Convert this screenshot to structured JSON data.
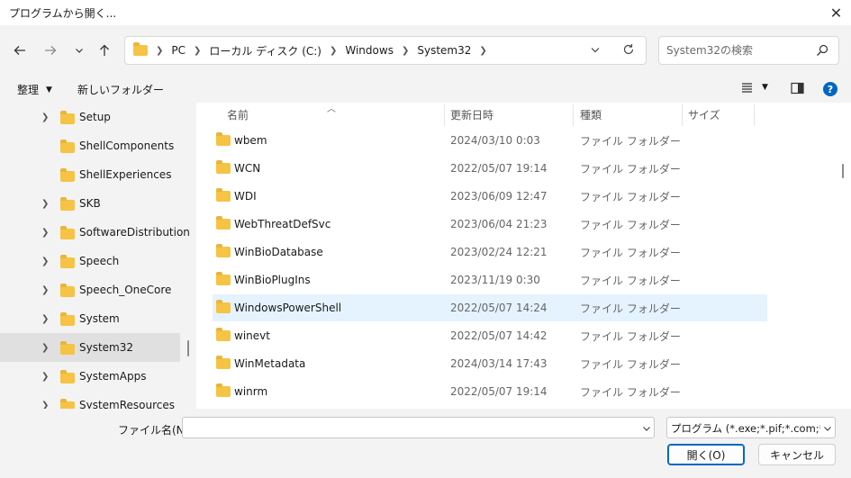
{
  "window": {
    "title": "プログラムから開く..."
  },
  "breadcrumb": [
    "PC",
    "ローカル ディスク (C:)",
    "Windows",
    "System32"
  ],
  "search": {
    "placeholder": "System32の検索"
  },
  "commandbar": {
    "organize": "整理",
    "new_folder": "新しいフォルダー"
  },
  "tree": [
    {
      "label": "Setup",
      "expandable": true
    },
    {
      "label": "ShellComponents",
      "expandable": false
    },
    {
      "label": "ShellExperiences",
      "expandable": false
    },
    {
      "label": "SKB",
      "expandable": true
    },
    {
      "label": "SoftwareDistribution",
      "expandable": true
    },
    {
      "label": "Speech",
      "expandable": true
    },
    {
      "label": "Speech_OneCore",
      "expandable": true
    },
    {
      "label": "System",
      "expandable": true
    },
    {
      "label": "System32",
      "expandable": true,
      "selected": true
    },
    {
      "label": "SystemApps",
      "expandable": true
    },
    {
      "label": "SystemResources",
      "expandable": true
    }
  ],
  "columns": {
    "name": "名前",
    "date": "更新日時",
    "type": "種類",
    "size": "サイズ"
  },
  "files": [
    {
      "name": "wbem",
      "date": "2024/03/10 0:03",
      "type": "ファイル フォルダー"
    },
    {
      "name": "WCN",
      "date": "2022/05/07 19:14",
      "type": "ファイル フォルダー"
    },
    {
      "name": "WDI",
      "date": "2023/06/09 12:47",
      "type": "ファイル フォルダー"
    },
    {
      "name": "WebThreatDefSvc",
      "date": "2023/06/04 21:23",
      "type": "ファイル フォルダー"
    },
    {
      "name": "WinBioDatabase",
      "date": "2023/02/24 12:21",
      "type": "ファイル フォルダー"
    },
    {
      "name": "WinBioPlugIns",
      "date": "2023/11/19 0:30",
      "type": "ファイル フォルダー"
    },
    {
      "name": "WindowsPowerShell",
      "date": "2022/05/07 14:24",
      "type": "ファイル フォルダー",
      "selected": true
    },
    {
      "name": "winevt",
      "date": "2022/05/07 14:42",
      "type": "ファイル フォルダー"
    },
    {
      "name": "WinMetadata",
      "date": "2024/03/14 17:43",
      "type": "ファイル フォルダー"
    },
    {
      "name": "winrm",
      "date": "2022/05/07 19:14",
      "type": "ファイル フォルダー"
    }
  ],
  "footer": {
    "filename_label": "ファイル名(N):",
    "filename_value": "",
    "filter": "プログラム (*.exe;*.pif;*.com;*.bat",
    "open": "開く(O)",
    "cancel": "キャンセル"
  },
  "colors": {
    "accent": "#0067c0",
    "folder": "#f6c344",
    "selected_row": "#e5f3ff"
  }
}
